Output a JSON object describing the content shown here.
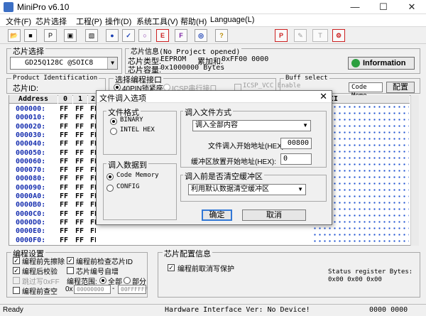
{
  "app": {
    "title": "MiniPro v6.10"
  },
  "menu": [
    "文件(F)",
    "芯片选择",
    "工程(P)",
    "操作(D)",
    "系统工具(V)",
    "帮助(H)",
    "Language(L)"
  ],
  "toolbar": {
    "icons": [
      "open-icon",
      "save-icon",
      "project-icon",
      "image-icon",
      "save-proj-icon",
      "read-icon",
      "verify-icon",
      "blank-icon",
      "erase-icon",
      "fill-icon",
      "protect-icon",
      "help-icon",
      "program-icon",
      "batch-icon",
      "test-icon",
      "tools-icon"
    ]
  },
  "chip_select": {
    "group": "芯片选择",
    "value": "GD25Q128C @SOIC8"
  },
  "chip_info": {
    "group": "芯片信息(No Project opened)",
    "type_label": "芯片类型:",
    "type_value": "EEPROM",
    "checksum_label": "累加和:",
    "checksum_value": "0xFF00 0000",
    "capacity_label": "芯片容量:",
    "capacity_value": "0x1000000 Bytes"
  },
  "info_button": "Information",
  "product_id": {
    "group": "Product Identification",
    "label": "芯片ID:"
  },
  "interface": {
    "group": "选择编程接口",
    "zif": "40PIN锁紧座",
    "icsp": "ICSP串行接口",
    "icsp_vcc": "ICSP_VCC Enable"
  },
  "buffer": {
    "group": "Buff select",
    "code_memo": "Code Memo",
    "config_btn": "配置"
  },
  "grid": {
    "headers": [
      "Address",
      "0",
      "1",
      "2"
    ],
    "ascii_header": "II",
    "addresses": [
      "000000:",
      "000010:",
      "000020:",
      "000030:",
      "000040:",
      "000050:",
      "000060:",
      "000070:",
      "000080:",
      "000090:",
      "0000A0:",
      "0000B0:",
      "0000C0:",
      "0000D0:",
      "0000E0:",
      "0000F0:"
    ],
    "cell": "FF"
  },
  "dialog": {
    "title": "文件调入选项",
    "format_group": "文件格式",
    "formats": [
      "BINARY",
      "INTEL HEX"
    ],
    "method_group": "调入文件方式",
    "method_value": "调入全部内容",
    "start_label": "文件调入开始地址(HEX):",
    "start_value": "00800",
    "buffer_label": "缓冲区放置开始地址(HEX):",
    "buffer_value": "0",
    "target_group": "调入数据到",
    "targets": [
      "Code Memory",
      "CONFIG"
    ],
    "clear_group": "调入前是否清空缓冲区",
    "clear_value": "利用默认数据清空缓冲区",
    "ok": "确定",
    "cancel": "取消"
  },
  "prog_settings": {
    "group": "编程设置",
    "blank": "编程前先擦除",
    "check_id": "编程前检查芯片ID",
    "verify": "编程后校验",
    "auto_inc": "芯片编号自增",
    "skip_ff": "跳过写0xFF",
    "range_label": "编程范围:",
    "all": "全部",
    "part": "部分",
    "blank_check": "编程前查空",
    "range_from": "00000000",
    "range_to": "00FFFFFF"
  },
  "config_info": {
    "group": "芯片配置信息",
    "write_protect": "编程前取消写保护",
    "status": "Status register Bytes:",
    "status_value": "0x00 0x00 0x00"
  },
  "statusbar": {
    "left": "Ready",
    "hw": "Hardware Interface Ver: No Device!",
    "right": "0000 0000"
  },
  "colors": {
    "address": "#1830b0",
    "accent": "#3278d6",
    "info_green": "#2b9f3f"
  }
}
